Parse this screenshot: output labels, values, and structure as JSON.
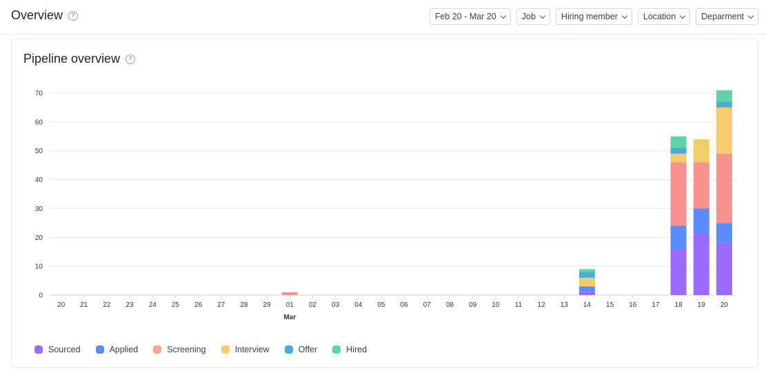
{
  "header": {
    "title": "Overview",
    "filters": [
      {
        "label": "Feb 20 - Mar 20"
      },
      {
        "label": "Job"
      },
      {
        "label": "Hiring member"
      },
      {
        "label": "Location"
      },
      {
        "label": "Deparment"
      }
    ]
  },
  "card": {
    "title": "Pipeline overview"
  },
  "chart_data": {
    "type": "bar",
    "stacked": true,
    "title": "Pipeline overview",
    "categories": [
      "20",
      "21",
      "22",
      "23",
      "24",
      "25",
      "26",
      "27",
      "28",
      "29",
      "01",
      "02",
      "03",
      "04",
      "05",
      "06",
      "07",
      "08",
      "09",
      "10",
      "11",
      "12",
      "13",
      "14",
      "15",
      "16",
      "17",
      "18",
      "19",
      "20"
    ],
    "month_label": {
      "category_index": 10,
      "text": "Mar"
    },
    "ylim": [
      0,
      70
    ],
    "yticks": [
      0,
      10,
      20,
      30,
      40,
      50,
      60,
      70
    ],
    "grid": true,
    "legend_position": "bottom-left",
    "series": [
      {
        "name": "Sourced",
        "color": "#9b6bff",
        "values": [
          0,
          0,
          0,
          0,
          0,
          0,
          0,
          0,
          0,
          0,
          0,
          0,
          0,
          0,
          0,
          0,
          0,
          0,
          0,
          0,
          0,
          0,
          0,
          1,
          0,
          0,
          0,
          16,
          21,
          18
        ]
      },
      {
        "name": "Applied",
        "color": "#5b8cff",
        "values": [
          0,
          0,
          0,
          0,
          0,
          0,
          0,
          0,
          0,
          0,
          0,
          0,
          0,
          0,
          0,
          0,
          0,
          0,
          0,
          0,
          0,
          0,
          0,
          2,
          0,
          0,
          0,
          8,
          9,
          7
        ]
      },
      {
        "name": "Screening",
        "color": "#f99191",
        "values": [
          0,
          0,
          0,
          0,
          0,
          0,
          0,
          0,
          0,
          0,
          1,
          0,
          0,
          0,
          0,
          0,
          0,
          0,
          0,
          0,
          0,
          0,
          0,
          0,
          0,
          0,
          0,
          22,
          16,
          24
        ]
      },
      {
        "name": "Interview",
        "color": "#f3cd6b",
        "values": [
          0,
          0,
          0,
          0,
          0,
          0,
          0,
          0,
          0,
          0,
          0,
          0,
          0,
          0,
          0,
          0,
          0,
          0,
          0,
          0,
          0,
          0,
          0,
          3,
          0,
          0,
          0,
          3,
          8,
          16
        ]
      },
      {
        "name": "Offer",
        "color": "#4fadd1",
        "values": [
          0,
          0,
          0,
          0,
          0,
          0,
          0,
          0,
          0,
          0,
          0,
          0,
          0,
          0,
          0,
          0,
          0,
          0,
          0,
          0,
          0,
          0,
          0,
          2,
          0,
          0,
          0,
          2,
          0,
          2
        ]
      },
      {
        "name": "Hired",
        "color": "#5fd4a8",
        "values": [
          0,
          0,
          0,
          0,
          0,
          0,
          0,
          0,
          0,
          0,
          0,
          0,
          0,
          0,
          0,
          0,
          0,
          0,
          0,
          0,
          0,
          0,
          0,
          1,
          0,
          0,
          0,
          4,
          0,
          4
        ]
      }
    ]
  },
  "legend": [
    {
      "name": "Sourced",
      "color": "#9b6bff"
    },
    {
      "name": "Applied",
      "color": "#5b8cff"
    },
    {
      "name": "Screening",
      "color": "#f7a98e"
    },
    {
      "name": "Interview",
      "color": "#f3cd6b"
    },
    {
      "name": "Offer",
      "color": "#4fadd1"
    },
    {
      "name": "Hired",
      "color": "#5fd4a8"
    }
  ]
}
